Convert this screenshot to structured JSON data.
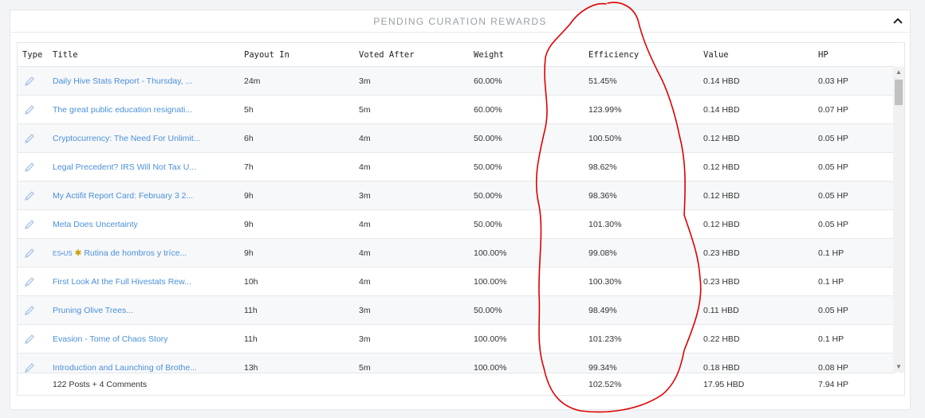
{
  "panel": {
    "title": "PENDING CURATION REWARDS"
  },
  "columns": {
    "type": "Type",
    "title": "Title",
    "payout_in": "Payout In",
    "voted_after": "Voted After",
    "weight": "Weight",
    "efficiency": "Efficiency",
    "value": "Value",
    "hp": "HP"
  },
  "rows": [
    {
      "title": "Daily Hive Stats Report - Thursday, ...",
      "payout_in": "24m",
      "voted_after": "3m",
      "weight": "60.00%",
      "efficiency": "51.45%",
      "value": "0.14 HBD",
      "hp": "0.03 HP"
    },
    {
      "title": "The great public education resignati...",
      "payout_in": "5h",
      "voted_after": "5m",
      "weight": "60.00%",
      "efficiency": "123.99%",
      "value": "0.14 HBD",
      "hp": "0.07 HP"
    },
    {
      "title": "Cryptocurrency: The Need For Unlimit...",
      "payout_in": "6h",
      "voted_after": "4m",
      "weight": "50.00%",
      "efficiency": "100.50%",
      "value": "0.12 HBD",
      "hp": "0.05 HP"
    },
    {
      "title": "Legal Precedent? IRS Will Not Tax U...",
      "payout_in": "7h",
      "voted_after": "4m",
      "weight": "50.00%",
      "efficiency": "98.62%",
      "value": "0.12 HBD",
      "hp": "0.05 HP"
    },
    {
      "title": "My Actifit Report Card: February 3 2...",
      "payout_in": "9h",
      "voted_after": "3m",
      "weight": "50.00%",
      "efficiency": "98.36%",
      "value": "0.12 HBD",
      "hp": "0.05 HP"
    },
    {
      "title": "Meta Does Uncertainty",
      "payout_in": "9h",
      "voted_after": "4m",
      "weight": "50.00%",
      "efficiency": "101.30%",
      "value": "0.12 HBD",
      "hp": "0.05 HP"
    },
    {
      "title": "Rutina de hombros y tríce...",
      "prefix": "ES•US",
      "payout_in": "9h",
      "voted_after": "4m",
      "weight": "100.00%",
      "efficiency": "99.08%",
      "value": "0.23 HBD",
      "hp": "0.1 HP"
    },
    {
      "title": "First Look At the Full Hivestats Rew...",
      "payout_in": "10h",
      "voted_after": "4m",
      "weight": "100.00%",
      "efficiency": "100.30%",
      "value": "0.23 HBD",
      "hp": "0.1 HP"
    },
    {
      "title": "Pruning Olive Trees...",
      "payout_in": "11h",
      "voted_after": "3m",
      "weight": "50.00%",
      "efficiency": "98.49%",
      "value": "0.11 HBD",
      "hp": "0.05 HP"
    },
    {
      "title": "Evasion - Tome of Chaos Story",
      "payout_in": "11h",
      "voted_after": "3m",
      "weight": "100.00%",
      "efficiency": "101.23%",
      "value": "0.22 HBD",
      "hp": "0.1 HP"
    },
    {
      "title": "Introduction and Launching of Brothe...",
      "payout_in": "13h",
      "voted_after": "5m",
      "weight": "100.00%",
      "efficiency": "99.34%",
      "value": "0.18 HBD",
      "hp": "0.08 HP"
    }
  ],
  "footer": {
    "summary": "122 Posts + 4 Comments",
    "efficiency": "102.52%",
    "value": "17.95 HBD",
    "hp": "7.94 HP"
  },
  "colors": {
    "link": "#4a90d9",
    "annotation": "#e00000"
  },
  "icons": {
    "type": "pencil-icon",
    "collapse": "chevron-up-icon"
  }
}
